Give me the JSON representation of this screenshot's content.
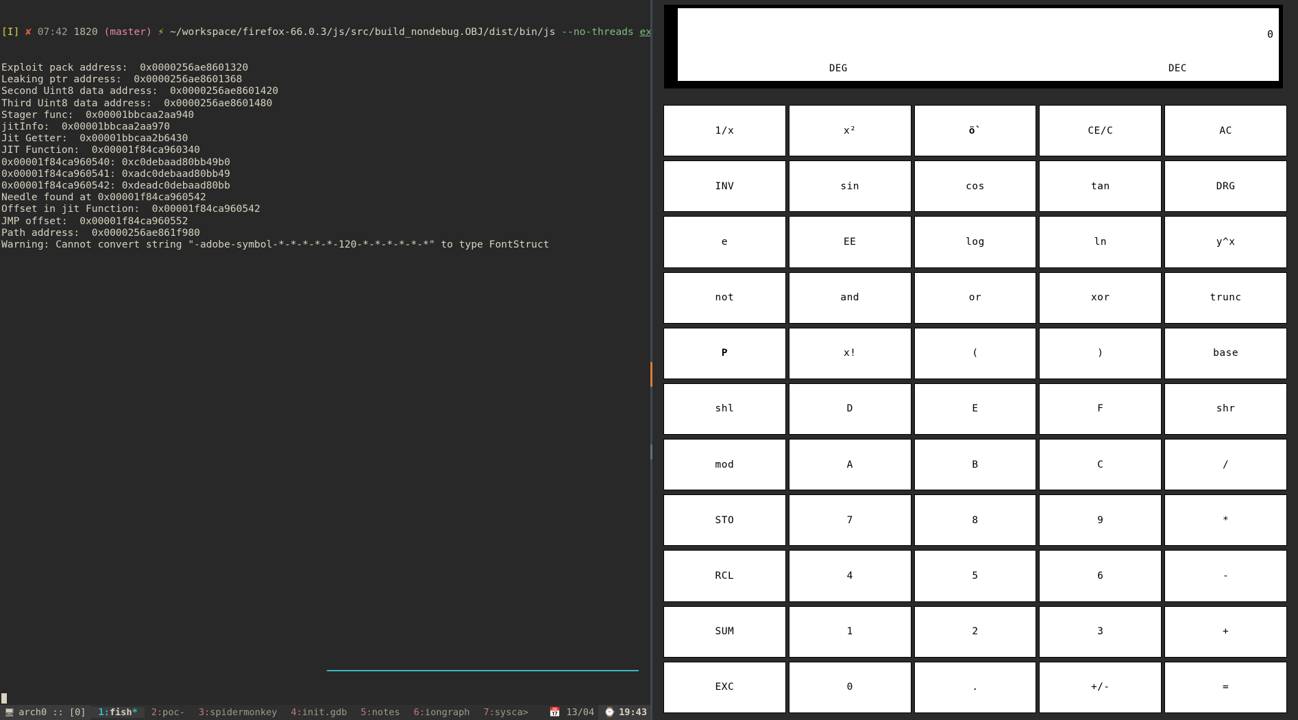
{
  "terminal": {
    "prompt": {
      "mode": "[I]",
      "status_icon": "✘",
      "time": "07:42",
      "pid": "1820",
      "branch": "(master)",
      "arrow": "⚡",
      "path": "~/workspace/firefox-66.0.3/js/src/build_nondebug.OBJ/dist/bin/js",
      "flag": "--no-threads",
      "file": "exploit.js"
    },
    "lines": [
      "Exploit pack address:  0x0000256ae8601320",
      "Leaking ptr address:  0x0000256ae8601368",
      "Second Uint8 data address:  0x0000256ae8601420",
      "Third Uint8 data address:  0x0000256ae8601480",
      "Stager func:  0x00001bbcaa2aa940",
      "jitInfo:  0x00001bbcaa2aa970",
      "Jit Getter:  0x00001bbcaa2b6430",
      "JIT Function:  0x00001f84ca960340",
      "0x00001f84ca960540: 0xc0debaad80bb49b0",
      "0x00001f84ca960541: 0xadc0debaad80bb49",
      "0x00001f84ca960542: 0xdeadc0debaad80bb",
      "Needle found at 0x00001f84ca960542",
      "Offset in jit Function:  0x00001f84ca960542",
      "JMP offset:  0x00001f84ca960552",
      "Path address:  0x0000256ae861f980",
      "Warning: Cannot convert string \"-adobe-symbol-*-*-*-*-*-120-*-*-*-*-*-*\" to type FontStruct"
    ]
  },
  "statusbar": {
    "host_icon": "🖥",
    "host": "arch0 :: [0]",
    "windows": [
      {
        "num": "1",
        "name": "fish",
        "flag": "*",
        "active": true
      },
      {
        "num": "2",
        "name": "poc-",
        "flag": "",
        "active": false
      },
      {
        "num": "3",
        "name": "spidermonkey",
        "flag": "",
        "active": false
      },
      {
        "num": "4",
        "name": "init.gdb",
        "flag": "",
        "active": false
      },
      {
        "num": "5",
        "name": "notes",
        "flag": "",
        "active": false
      },
      {
        "num": "6",
        "name": "iongraph",
        "flag": "",
        "active": false
      },
      {
        "num": "7",
        "name": "sysca>",
        "flag": "",
        "active": false
      }
    ],
    "date_icon": "📅",
    "date": "13/04",
    "time_icon": "⌚",
    "time": "19:43"
  },
  "calculator": {
    "display": {
      "value": "0",
      "angle_mode": "DEG",
      "base_mode": "DEC"
    },
    "keys": [
      {
        "label": "1/x",
        "name": "reciprocal",
        "bold": false
      },
      {
        "label": "x²",
        "name": "square",
        "bold": false
      },
      {
        "label": "ö`",
        "name": "sqrt",
        "bold": true
      },
      {
        "label": "CE/C",
        "name": "clear-entry",
        "bold": false
      },
      {
        "label": "AC",
        "name": "all-clear",
        "bold": false
      },
      {
        "label": "INV",
        "name": "inverse",
        "bold": false
      },
      {
        "label": "sin",
        "name": "sin",
        "bold": false
      },
      {
        "label": "cos",
        "name": "cos",
        "bold": false
      },
      {
        "label": "tan",
        "name": "tan",
        "bold": false
      },
      {
        "label": "DRG",
        "name": "drg",
        "bold": false
      },
      {
        "label": "e",
        "name": "euler",
        "bold": false
      },
      {
        "label": "EE",
        "name": "exponent",
        "bold": false
      },
      {
        "label": "log",
        "name": "log",
        "bold": false
      },
      {
        "label": "ln",
        "name": "ln",
        "bold": false
      },
      {
        "label": "y^x",
        "name": "power",
        "bold": false
      },
      {
        "label": "not",
        "name": "not",
        "bold": false
      },
      {
        "label": "and",
        "name": "and",
        "bold": false
      },
      {
        "label": "or",
        "name": "or",
        "bold": false
      },
      {
        "label": "xor",
        "name": "xor",
        "bold": false
      },
      {
        "label": "trunc",
        "name": "trunc",
        "bold": false
      },
      {
        "label": "P",
        "name": "pi",
        "bold": true
      },
      {
        "label": "x!",
        "name": "factorial",
        "bold": false
      },
      {
        "label": "(",
        "name": "open-paren",
        "bold": false
      },
      {
        "label": ")",
        "name": "close-paren",
        "bold": false
      },
      {
        "label": "base",
        "name": "base",
        "bold": false
      },
      {
        "label": "shl",
        "name": "shift-left",
        "bold": false
      },
      {
        "label": "D",
        "name": "hex-d",
        "bold": false
      },
      {
        "label": "E",
        "name": "hex-e",
        "bold": false
      },
      {
        "label": "F",
        "name": "hex-f",
        "bold": false
      },
      {
        "label": "shr",
        "name": "shift-right",
        "bold": false
      },
      {
        "label": "mod",
        "name": "modulo",
        "bold": false
      },
      {
        "label": "A",
        "name": "hex-a",
        "bold": false
      },
      {
        "label": "B",
        "name": "hex-b",
        "bold": false
      },
      {
        "label": "C",
        "name": "hex-c",
        "bold": false
      },
      {
        "label": "/",
        "name": "divide",
        "bold": false
      },
      {
        "label": "STO",
        "name": "store",
        "bold": false
      },
      {
        "label": "7",
        "name": "digit-7",
        "bold": false
      },
      {
        "label": "8",
        "name": "digit-8",
        "bold": false
      },
      {
        "label": "9",
        "name": "digit-9",
        "bold": false
      },
      {
        "label": "*",
        "name": "multiply",
        "bold": false
      },
      {
        "label": "RCL",
        "name": "recall",
        "bold": false
      },
      {
        "label": "4",
        "name": "digit-4",
        "bold": false
      },
      {
        "label": "5",
        "name": "digit-5",
        "bold": false
      },
      {
        "label": "6",
        "name": "digit-6",
        "bold": false
      },
      {
        "label": "-",
        "name": "subtract",
        "bold": false
      },
      {
        "label": "SUM",
        "name": "sum",
        "bold": false
      },
      {
        "label": "1",
        "name": "digit-1",
        "bold": false
      },
      {
        "label": "2",
        "name": "digit-2",
        "bold": false
      },
      {
        "label": "3",
        "name": "digit-3",
        "bold": false
      },
      {
        "label": "+",
        "name": "add",
        "bold": false
      },
      {
        "label": "EXC",
        "name": "exchange",
        "bold": false
      },
      {
        "label": "0",
        "name": "digit-0",
        "bold": false
      },
      {
        "label": ".",
        "name": "decimal",
        "bold": false
      },
      {
        "label": "+/-",
        "name": "negate",
        "bold": false
      },
      {
        "label": "=",
        "name": "equals",
        "bold": false
      }
    ]
  },
  "colors": {
    "terminal_bg": "#282828",
    "terminal_fg": "#d8d3c0",
    "accent_cyan": "#3bb7c4",
    "accent_orange": "#e07b39",
    "calc_key_bg": "#ffffff"
  }
}
